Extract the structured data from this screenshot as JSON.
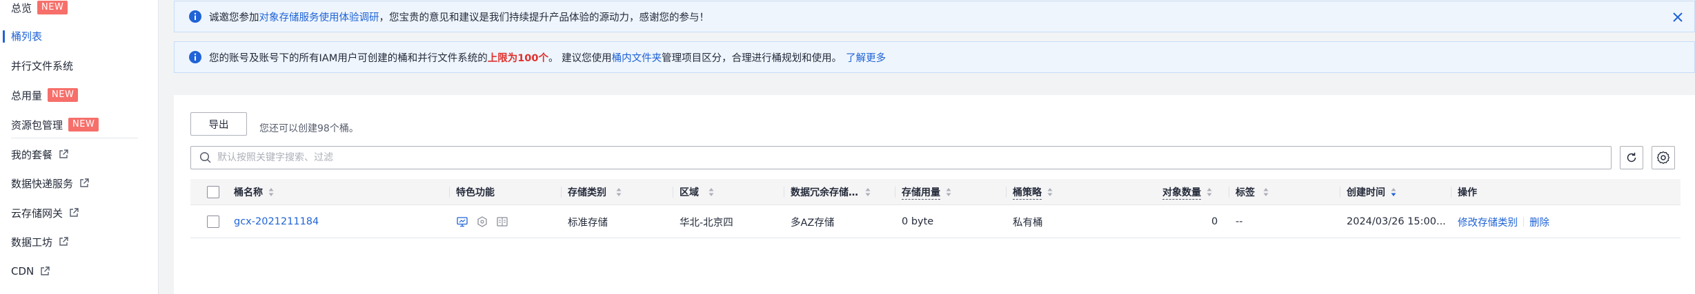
{
  "sidebar": {
    "items": [
      {
        "label": "总览",
        "badge": "NEW"
      },
      {
        "label": "桶列表"
      },
      {
        "label": "并行文件系统"
      },
      {
        "label": "总用量",
        "badge": "NEW"
      },
      {
        "label": "资源包管理",
        "badge": "NEW"
      },
      {
        "label": "我的套餐"
      },
      {
        "label": "数据快递服务"
      },
      {
        "label": "云存储网关"
      },
      {
        "label": "数据工坊"
      },
      {
        "label": "CDN"
      }
    ]
  },
  "notice1": {
    "prefix": "诚邀您参加",
    "link": "对象存储服务使用体验调研",
    "suffix": "，您宝贵的意见和建议是我们持续提升产品体验的源动力，感谢您的参与！"
  },
  "notice2": {
    "prefix": "您的账号及账号下的所有IAM用户可创建的桶和并行文件系统的",
    "highlight": "上限为100个",
    "middle": "。 建议您使用",
    "link1": "桶内文件夹",
    "suffix": "管理项目区分，合理进行桶规划和使用。",
    "link2": "了解更多"
  },
  "toolbar": {
    "export_label": "导出",
    "quota_text": "您还可以创建98个桶。",
    "search_placeholder": "默认按照关键字搜索、过滤"
  },
  "table": {
    "headers": [
      "桶名称",
      "特色功能",
      "存储类别",
      "区域",
      "数据冗余存储…",
      "存储用量",
      "桶策略",
      "对象数量",
      "标签",
      "创建时间",
      "操作"
    ],
    "rows": [
      {
        "name": "gcx-2021211184",
        "storage_class": "标准存储",
        "region": "华北-北京四",
        "redundancy": "多AZ存储",
        "usage": "0 byte",
        "policy": "私有桶",
        "object_count": "0",
        "tags": "--",
        "created": "2024/03/26 15:00...",
        "action_modify": "修改存储类别",
        "action_delete": "删除"
      }
    ]
  },
  "colors": {
    "accent": "#1f63d6",
    "badge": "#f66f6a",
    "notice_bg": "#eef5fd",
    "highlight_red": "#e0312c"
  }
}
